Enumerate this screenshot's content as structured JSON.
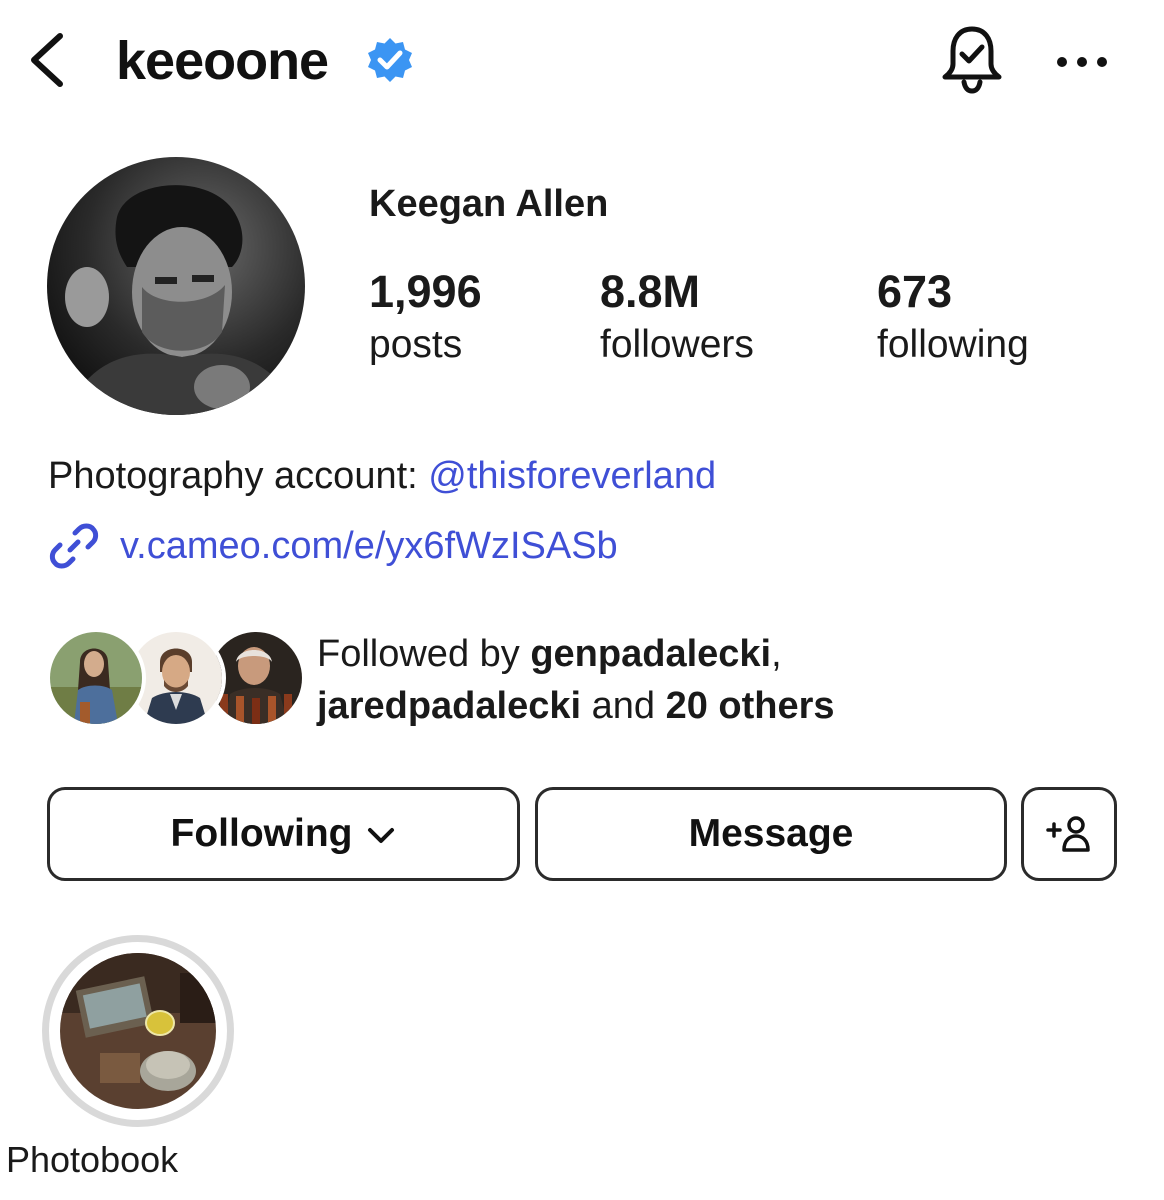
{
  "header": {
    "username": "keeoone",
    "back_icon": "chevron-left-icon",
    "verified_icon": "verified-badge-icon",
    "bell_icon": "notification-bell-check-icon",
    "more_icon": "more-horizontal-icon"
  },
  "profile": {
    "display_name": "Keegan Allen",
    "stats": [
      {
        "value": "1,996",
        "label": "posts"
      },
      {
        "value": "8.8M",
        "label": "followers"
      },
      {
        "value": "673",
        "label": "following"
      }
    ]
  },
  "bio": {
    "prefix": "Photography account: ",
    "mention": "@thisforeverland",
    "link_icon": "link-icon",
    "link": "v.cameo.com/e/yx6fWzISASb"
  },
  "followed_by": {
    "prefix": "Followed by ",
    "user1": "genpadalecki",
    "comma": ",",
    "user2": "jaredpadalecki",
    "and": " and ",
    "others": "20 others"
  },
  "actions": {
    "following_label": "Following",
    "following_chevron_icon": "chevron-down-icon",
    "message_label": "Message",
    "add_user_icon": "add-user-icon"
  },
  "highlights": [
    {
      "label": "Photobook"
    }
  ],
  "colors": {
    "link": "#3f4fd6",
    "verified": "#3b95f3",
    "text": "#111111",
    "border": "#2b2b2b",
    "highlight_ring": "#d9d9d9"
  }
}
